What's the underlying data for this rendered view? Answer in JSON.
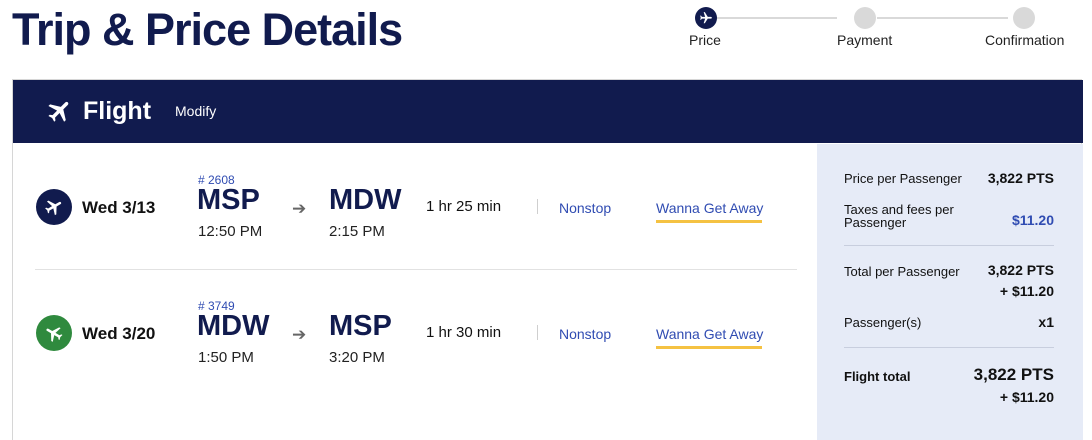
{
  "page": {
    "title": "Trip & Price Details"
  },
  "stepper": {
    "steps": [
      {
        "label": "Price",
        "active": true
      },
      {
        "label": "Payment",
        "active": false
      },
      {
        "label": "Confirmation",
        "active": false
      }
    ]
  },
  "header": {
    "title": "Flight",
    "modify_label": "Modify",
    "icon": "airplane-icon"
  },
  "flights": [
    {
      "date": "Wed 3/13",
      "flight_number": "# 2608",
      "depart_code": "MSP",
      "depart_time": "12:50 PM",
      "arrive_code": "MDW",
      "arrive_time": "2:15 PM",
      "duration": "1 hr 25 min",
      "stops": "Nonstop",
      "fare": "Wanna Get Away"
    },
    {
      "date": "Wed 3/20",
      "flight_number": "# 3749",
      "depart_code": "MDW",
      "depart_time": "1:50 PM",
      "arrive_code": "MSP",
      "arrive_time": "3:20 PM",
      "duration": "1 hr 30 min",
      "stops": "Nonstop",
      "fare": "Wanna Get Away"
    }
  ],
  "arrow_glyph": "➔",
  "summary": {
    "price_per_passenger_label": "Price per Passenger",
    "price_per_passenger_value": "3,822 PTS",
    "taxes_label_line1": "Taxes and fees per",
    "taxes_label_line2": "Passenger",
    "taxes_value": "$11.20",
    "total_per_passenger_label": "Total per Passenger",
    "total_per_passenger_value_line1": "3,822 PTS",
    "total_per_passenger_value_line2": "+ $11.20",
    "passengers_label": "Passenger(s)",
    "passengers_value": "x1",
    "flight_total_label": "Flight total",
    "flight_total_value_line1": "3,822 PTS",
    "flight_total_value_line2": "+ $11.20"
  },
  "colors": {
    "navy": "#111b4e",
    "link_blue": "#304cb2",
    "green": "#2f8a3e",
    "fare_underline": "#f5c242",
    "summary_bg": "#e6ebf7"
  }
}
